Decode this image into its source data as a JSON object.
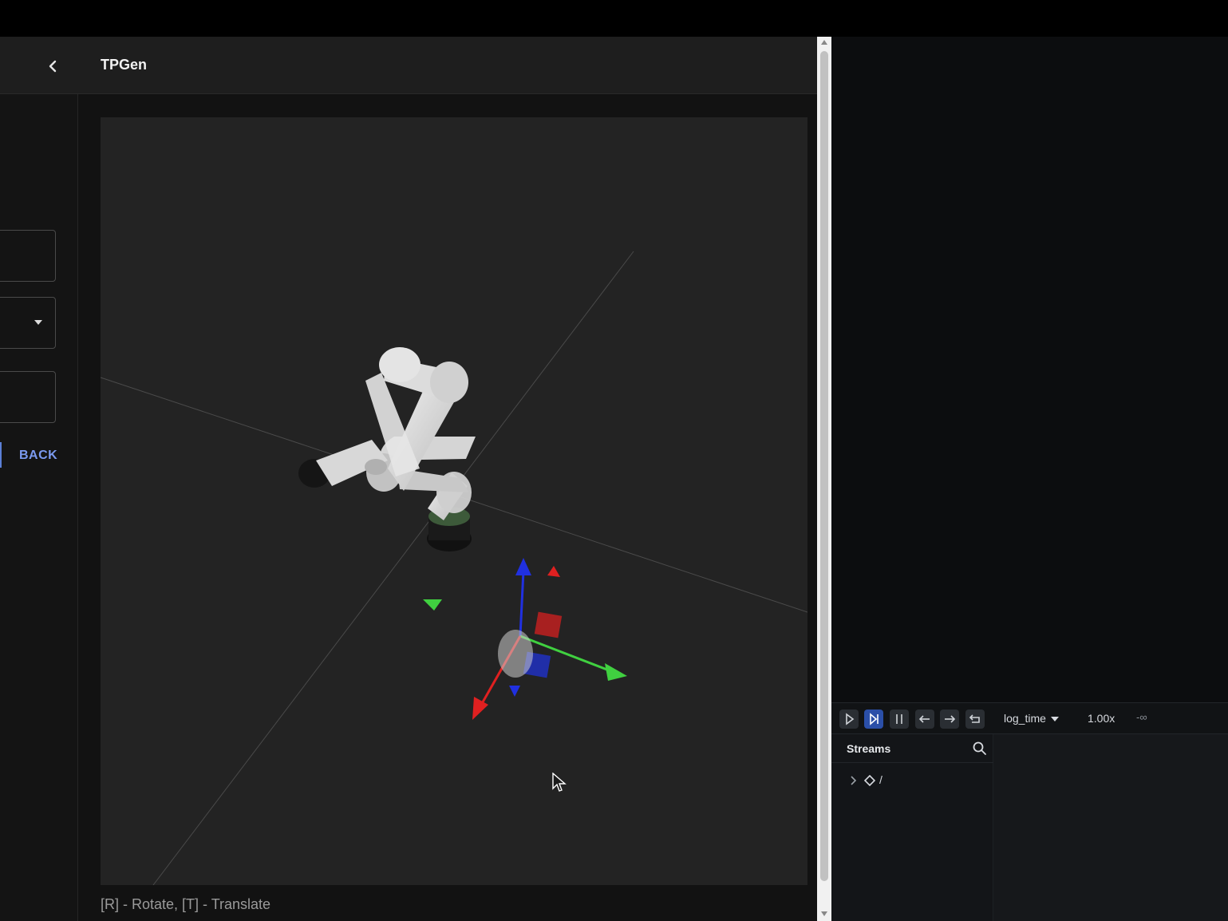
{
  "app": {
    "title": "TPGen",
    "viewport_hint": "[R] - Rotate, [T] - Translate"
  },
  "sidebar": {
    "back_label": "BACK",
    "collapse_icon": "chevron-left-icon"
  },
  "viewer": {
    "timeline_name": "log_time",
    "speed": "1.00x",
    "time_range": "-∞",
    "controls": [
      "play-icon",
      "step-forward-icon",
      "pause-icon",
      "step-back-icon",
      "step-next-icon",
      "loop-icon"
    ],
    "streams_title": "Streams",
    "stream_root": "/"
  },
  "colors": {
    "accent": "#7b9af0",
    "active_control": "#2b4fa8",
    "axis_x": "#e02020",
    "axis_y": "#40d040",
    "axis_z": "#2030e0"
  }
}
